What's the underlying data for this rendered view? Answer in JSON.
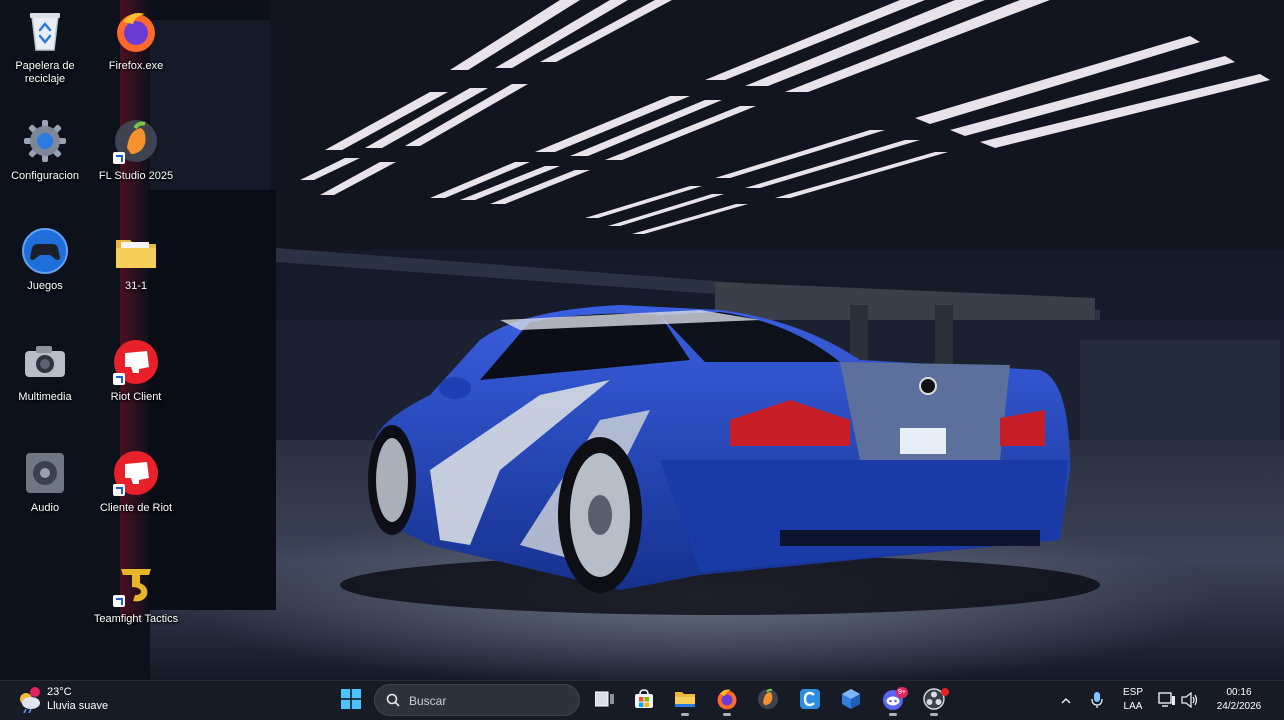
{
  "desktop": {
    "icons": [
      {
        "label": "Papelera de reciclaje",
        "icon": "recycle-bin-icon"
      },
      {
        "label": "Firefox.exe",
        "icon": "firefox-icon"
      },
      {
        "label": "Configuracion",
        "icon": "gear-icon"
      },
      {
        "label": "FL Studio 2025",
        "icon": "fl-studio-icon"
      },
      {
        "label": "Juegos",
        "icon": "gamepad-icon"
      },
      {
        "label": "31-1",
        "icon": "folder-icon"
      },
      {
        "label": "Multimedia",
        "icon": "camera-icon"
      },
      {
        "label": "Riot Client",
        "icon": "riot-client-icon"
      },
      {
        "label": "Audio",
        "icon": "speaker-icon"
      },
      {
        "label": "Cliente de Riot",
        "icon": "riot-client-icon"
      },
      {
        "label": "Teamfight Tactics",
        "icon": "teamfight-tactics-icon"
      }
    ]
  },
  "taskbar": {
    "weather": {
      "temperature": "23°C",
      "condition": "Lluvia suave",
      "icon": "weather-rain-icon"
    },
    "search": {
      "placeholder": "Buscar"
    },
    "apps": [
      {
        "name": "start",
        "icon": "windows-start-icon"
      },
      {
        "name": "task-view",
        "icon": "task-view-icon"
      },
      {
        "name": "store",
        "icon": "store-icon"
      },
      {
        "name": "file-explorer",
        "icon": "folder-icon"
      },
      {
        "name": "firefox",
        "icon": "firefox-icon"
      },
      {
        "name": "fl-studio",
        "icon": "fl-studio-icon"
      },
      {
        "name": "c-app",
        "icon": "c-app-icon"
      },
      {
        "name": "box-app",
        "icon": "box-app-icon"
      },
      {
        "name": "discord",
        "icon": "discord-icon",
        "badge": "9+"
      },
      {
        "name": "obs",
        "icon": "obs-icon"
      }
    ],
    "tray": {
      "language_top": "ESP",
      "language_bottom": "LAA",
      "time": "00:16",
      "date": "24/2/2026"
    }
  },
  "colors": {
    "taskbar_bg": "#181c26",
    "accent_blue": "#1f5fd1",
    "car_blue": "#1e3fb0",
    "badge_red": "#e0245e"
  }
}
